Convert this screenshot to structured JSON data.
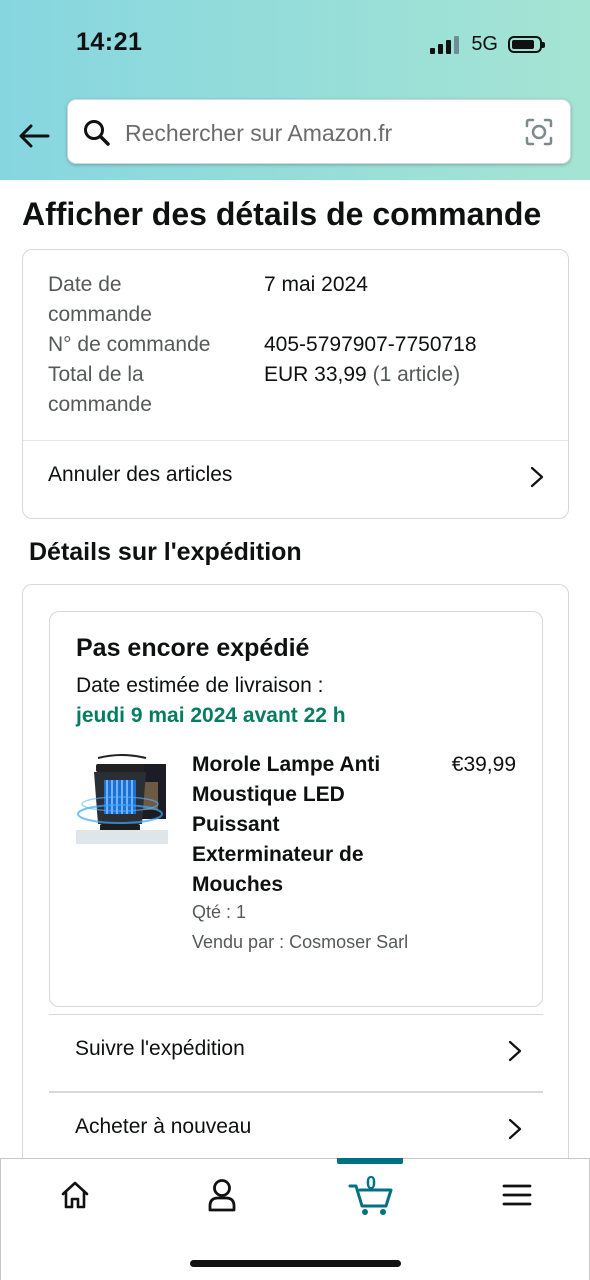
{
  "status_bar": {
    "time": "14:21",
    "network": "5G"
  },
  "search": {
    "placeholder": "Rechercher sur Amazon.fr"
  },
  "page": {
    "title": "Afficher des détails de commande"
  },
  "order_summary": {
    "date_label": "Date de commande",
    "date_value": "7 mai 2024",
    "number_label": "N° de commande",
    "number_value": "405-5797907-7750718",
    "total_label": "Total de la commande",
    "total_value": "EUR 33,99",
    "total_items": "(1 article)",
    "cancel_label": "Annuler des articles"
  },
  "shipment": {
    "section_title": "Détails sur l'expédition",
    "status": "Pas encore expédié",
    "estimate_label": "Date estimée de livraison :",
    "estimate_date": "jeudi 9 mai 2024 avant 22 h",
    "item": {
      "title": "Morole Lampe Anti Moustique LED Puissant Exterminateur de Mouches",
      "price": "€39,99",
      "quantity": "Qté : 1",
      "seller": "Vendu par : Cosmoser Sarl"
    },
    "track_label": "Suivre l'expédition",
    "buy_again_label": "Acheter à nouveau"
  },
  "tab_bar": {
    "cart_count": "0",
    "tabs": [
      {
        "icon": "home-icon"
      },
      {
        "icon": "account-icon"
      },
      {
        "icon": "cart-icon",
        "active": true
      },
      {
        "icon": "menu-icon"
      }
    ]
  },
  "colors": {
    "accent": "#007185",
    "delivery_green": "#067d62",
    "header_gradient_start": "#86d6e0",
    "header_gradient_end": "#a5e4d3"
  }
}
